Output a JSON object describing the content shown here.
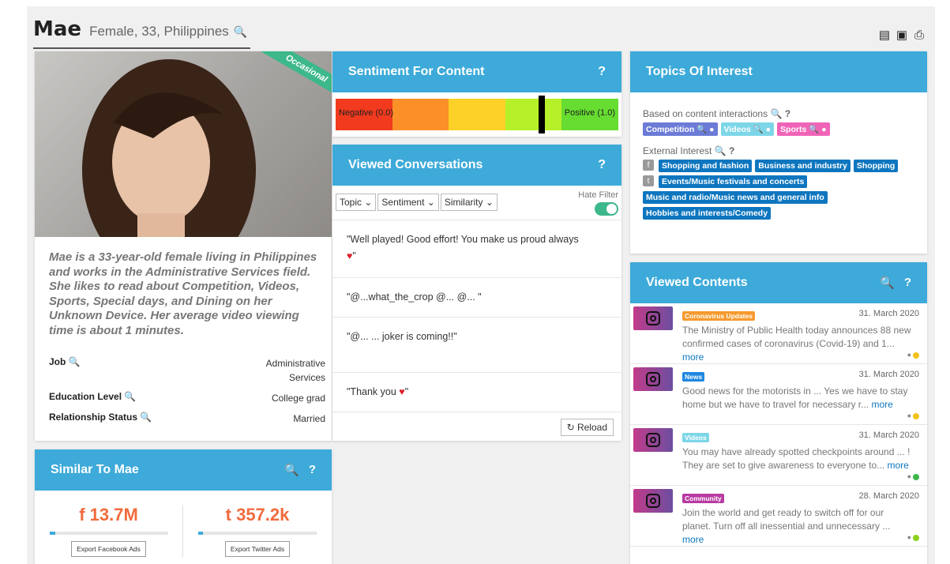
{
  "profile": {
    "name": "Mae",
    "subtitle": "Female, 33, Philippines",
    "badge": "Occasional",
    "bio": "Mae is a 33-year-old female living in Philippines and works in the Administrative Services field. She likes to read about Competition, Videos, Sports, Special days, and Dining on her Unknown Device. Her average video viewing time is about 1 minutes.",
    "facts": [
      {
        "label": "Job",
        "value": "Administrative Services"
      },
      {
        "label": "Education Level",
        "value": "College grad"
      },
      {
        "label": "Relationship Status",
        "value": "Married"
      }
    ]
  },
  "sentiment": {
    "title": "Sentiment For Content",
    "help": "?",
    "neg_label": "Negative (0.0)",
    "pos_label": "Positive (1.0)",
    "value": 0.73,
    "colors": [
      "#f23a1e",
      "#fb8f28",
      "#fdd127",
      "#b6f028",
      "#66dd30"
    ]
  },
  "conversations": {
    "title": "Viewed Conversations",
    "help": "?",
    "filters": [
      "Topic",
      "Sentiment",
      "Similarity"
    ],
    "hate_filter_label": "Hate Filter",
    "hate_filter_on": true,
    "items": [
      "\"Well played! Good effort! You make us proud always",
      "\"@...what_the_crop @...  @...   \"",
      "\"@...   ...   joker is coming!!\"",
      "\"Thank you"
    ],
    "reload_label": "Reload"
  },
  "topics": {
    "title": "Topics Of Interest",
    "content_label": "Based on content interactions",
    "content_tags": [
      {
        "label": "Competition",
        "color": "#6b7bd6"
      },
      {
        "label": "Videos",
        "color": "#7dd6e8"
      },
      {
        "label": "Sports",
        "color": "#f064b8"
      }
    ],
    "external_label": "External Interest",
    "fb_tags": [
      "Shopping and fashion",
      "Business and industry",
      "Shopping"
    ],
    "tw_tags": [
      "Events/Music festivals and concerts",
      "Music and radio/Music news and general info",
      "Hobbies and interests/Comedy"
    ]
  },
  "contents": {
    "title": "Viewed Contents",
    "help": "?",
    "items": [
      {
        "tag": "Coronavirus Updates",
        "tag_color": "#f59a2e",
        "date": "31. March 2020",
        "text": "The Ministry of Public Health today announces 88 new confirmed cases of coronavirus (Covid-19) and 1...",
        "more": "more",
        "sentiment_color": "#f2c21d"
      },
      {
        "tag": "News",
        "tag_color": "#1e87e0",
        "date": "31. March 2020",
        "text": "Good news for the motorists in ... Yes we have to stay home but we have to travel for necessary r...",
        "more": "more",
        "sentiment_color": "#f2c21d"
      },
      {
        "tag": "Videos",
        "tag_color": "#7dd6e8",
        "date": "31. March 2020",
        "text": "You may have already spotted checkpoints around ... ! They are set to give awareness to everyone to...",
        "more": "more",
        "sentiment_color": "#3db84a"
      },
      {
        "tag": "Community",
        "tag_color": "#b83aa1",
        "date": "28. March 2020",
        "text": "Join the world and get ready to switch off for our planet. Turn off all inessential and unnecessary ...",
        "more": "more",
        "sentiment_color": "#8bd11e"
      }
    ]
  },
  "similar": {
    "title": "Similar To Mae",
    "help": "?",
    "facebook_count": "13.7M",
    "twitter_count": "357.2k",
    "facebook_progress": 0.05,
    "twitter_progress": 0.04,
    "facebook_button": "Export Facebook Ads",
    "twitter_button": "Export Twitter Ads"
  }
}
